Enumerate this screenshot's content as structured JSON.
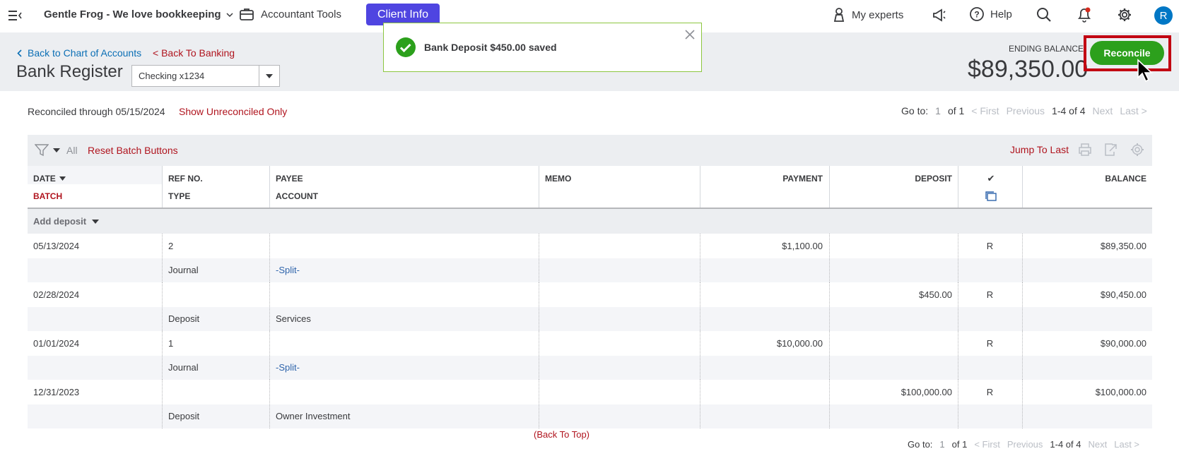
{
  "topnav": {
    "company": "Gentle Frog - We love bookkeeping",
    "accountant_tools": "Accountant Tools",
    "client_info": "Client Info",
    "my_experts": "My experts",
    "help": "Help",
    "avatar_initial": "R",
    "notification_color": "#d52b1e"
  },
  "header": {
    "back_chart": "Back to Chart of Accounts",
    "back_banking": "< Back To Banking",
    "title": "Bank Register",
    "account_select": "Checking x1234",
    "ending_label": "ENDING BALANCE",
    "ending_amount": "$89,350.00",
    "reconcile": "Reconcile"
  },
  "toast": {
    "message": "Bank Deposit $450.00 saved",
    "color": "#2ca01c"
  },
  "subheader": {
    "reconciled_through": "Reconciled through 05/15/2024",
    "show_unreconciled": "Show Unreconciled Only"
  },
  "pager": {
    "go_to": "Go to:",
    "page": "1",
    "of": "of 1",
    "first": "< First",
    "previous": "Previous",
    "range": "1-4 of 4",
    "next": "Next",
    "last": "Last >"
  },
  "toolbar": {
    "all": "All",
    "reset_batch": "Reset Batch Buttons",
    "jump_last": "Jump To Last"
  },
  "columns": {
    "date": "DATE",
    "batch": "BATCH",
    "ref_no": "REF NO.",
    "type": "TYPE",
    "payee": "PAYEE",
    "account": "ACCOUNT",
    "memo": "MEMO",
    "payment": "PAYMENT",
    "deposit": "DEPOSIT",
    "check": "✔",
    "balance": "BALANCE"
  },
  "add_deposit": "Add deposit",
  "transactions": [
    {
      "date": "05/13/2024",
      "ref": "2",
      "payee": "",
      "memo": "",
      "payment": "$1,100.00",
      "deposit": "",
      "status": "R",
      "balance": "$89,350.00",
      "type": "Journal",
      "account": "-Split-"
    },
    {
      "date": "02/28/2024",
      "ref": "",
      "payee": "",
      "memo": "",
      "payment": "",
      "deposit": "$450.00",
      "status": "R",
      "balance": "$90,450.00",
      "type": "Deposit",
      "account": "Services"
    },
    {
      "date": "01/01/2024",
      "ref": "1",
      "payee": "",
      "memo": "",
      "payment": "$10,000.00",
      "deposit": "",
      "status": "R",
      "balance": "$90,000.00",
      "type": "Journal",
      "account": "-Split-"
    },
    {
      "date": "12/31/2023",
      "ref": "",
      "payee": "",
      "memo": "",
      "payment": "",
      "deposit": "$100,000.00",
      "status": "R",
      "balance": "$100,000.00",
      "type": "Deposit",
      "account": "Owner Investment"
    }
  ],
  "back_to_top": "(Back To Top)"
}
